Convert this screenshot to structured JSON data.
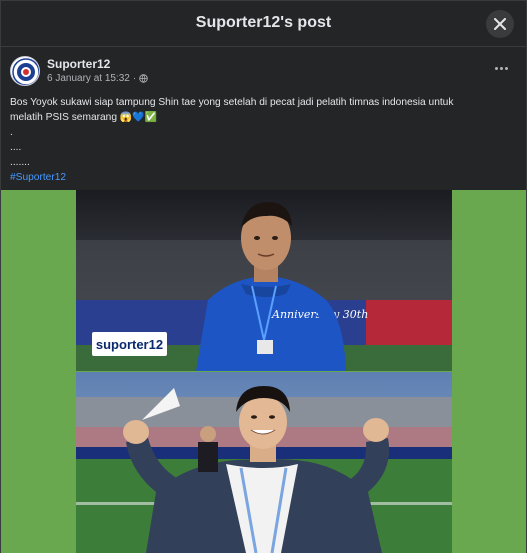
{
  "modal": {
    "title": "Suporter12's post",
    "close_icon": "close-icon"
  },
  "post": {
    "author": "Suporter12",
    "timestamp": "6 January at 15:32",
    "separator": "·",
    "audience_icon": "globe-icon",
    "more_icon": "more-options-icon",
    "text_line1": "Bos Yoyok sukawi siap tampung Shin tae yong setelah di pecat jadi pelatih timnas indonesia untuk",
    "text_line2": "melatih PSIS semarang",
    "emoji": "😱💙✅",
    "text_line3": ".",
    "text_line4": "....",
    "text_line5": ".......",
    "hashtag": "#Suporter12"
  },
  "media": {
    "watermark": "suporter12",
    "shirt_text": "Anniversary 30th"
  },
  "colors": {
    "background": "#242526",
    "text": "#e4e6eb",
    "secondary_text": "#b0b3b8",
    "link": "#4599ff",
    "media_background": "#6aa84f"
  }
}
